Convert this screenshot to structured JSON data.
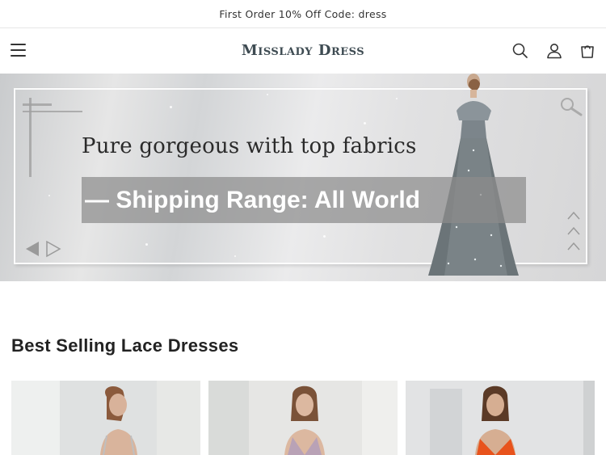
{
  "announcement": {
    "text": "First Order 10% Off Code: dress"
  },
  "header": {
    "logo": "Misslady Dress",
    "icons": [
      "menu-icon",
      "search-icon",
      "account-icon",
      "cart-icon"
    ]
  },
  "hero": {
    "tagline": "Pure gorgeous with top fabrics",
    "band_text": "— Shipping Range: All World"
  },
  "section": {
    "title": "Best Selling Lace Dresses"
  },
  "colors": {
    "text": "#222222",
    "logo": "#3e4b52",
    "band": "#8c8c8c",
    "dress": "#6b7478"
  }
}
